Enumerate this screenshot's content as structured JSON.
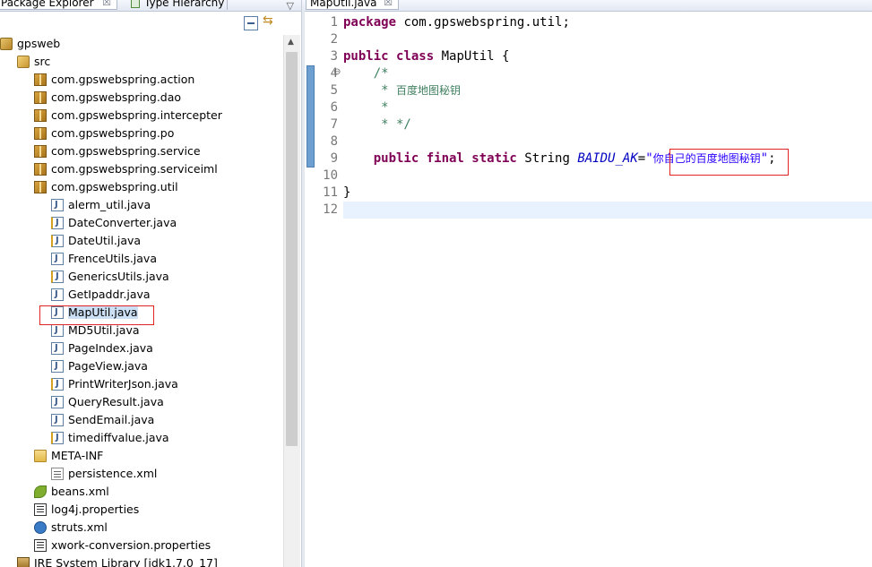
{
  "left_panel": {
    "tabs": [
      {
        "label": "Package Explorer",
        "close": "☒"
      },
      {
        "label": "Type Hierarchy"
      }
    ],
    "view_menu_icon": "▽",
    "toolbar": {
      "collapse_all_icon": "collapse-all-icon",
      "link_with_editor_icon": "⇆"
    },
    "tree": [
      {
        "label": "gpsweb",
        "icon": "project"
      },
      {
        "label": "src",
        "icon": "src"
      },
      {
        "label": "com.gpswebspring.action",
        "icon": "package"
      },
      {
        "label": "com.gpswebspring.dao",
        "icon": "package"
      },
      {
        "label": "com.gpswebspring.intercepter",
        "icon": "package"
      },
      {
        "label": "com.gpswebspring.po",
        "icon": "package"
      },
      {
        "label": "com.gpswebspring.service",
        "icon": "package"
      },
      {
        "label": "com.gpswebspring.serviceiml",
        "icon": "package"
      },
      {
        "label": "com.gpswebspring.util",
        "icon": "package"
      },
      {
        "label": "alerm_util.java",
        "icon": "java"
      },
      {
        "label": "DateConverter.java",
        "icon": "java-warn"
      },
      {
        "label": "DateUtil.java",
        "icon": "java-warn"
      },
      {
        "label": "FrenceUtils.java",
        "icon": "java"
      },
      {
        "label": "GenericsUtils.java",
        "icon": "java-warn"
      },
      {
        "label": "GetIpaddr.java",
        "icon": "java"
      },
      {
        "label": "MapUtil.java",
        "icon": "java"
      },
      {
        "label": "MD5Util.java",
        "icon": "java"
      },
      {
        "label": "PageIndex.java",
        "icon": "java"
      },
      {
        "label": "PageView.java",
        "icon": "java"
      },
      {
        "label": "PrintWriterJson.java",
        "icon": "java-warn"
      },
      {
        "label": "QueryResult.java",
        "icon": "java"
      },
      {
        "label": "SendEmail.java",
        "icon": "java"
      },
      {
        "label": "timediffvalue.java",
        "icon": "java-warn"
      },
      {
        "label": "META-INF",
        "icon": "folder"
      },
      {
        "label": "persistence.xml",
        "icon": "xml"
      },
      {
        "label": "beans.xml",
        "icon": "leaf"
      },
      {
        "label": "log4j.properties",
        "icon": "props"
      },
      {
        "label": "struts.xml",
        "icon": "struts"
      },
      {
        "label": "xwork-conversion.properties",
        "icon": "props"
      },
      {
        "label": "JRE System Library [jdk1.7.0_17]",
        "icon": "library"
      }
    ]
  },
  "editor": {
    "tab": {
      "label": "MapUtil.java",
      "close": "☒"
    },
    "line_numbers": [
      "1",
      "2",
      "3",
      "4",
      "5",
      "6",
      "7",
      "8",
      "9",
      "10",
      "11",
      "12"
    ],
    "fold_marker": "⊖",
    "code": {
      "l1_kw": "package",
      "l1_rest": " com.gpswebspring.util;",
      "l3_kw1": "public",
      "l3_kw2": "class",
      "l3_rest": " MapUtil {",
      "l4": "    /*",
      "l5_prefix": "     * ",
      "l5_text": "百度地图秘钥",
      "l6": "     *",
      "l7": "     * */",
      "l9_kw": "public final static",
      "l9_type": " String ",
      "l9_field": "BAIDU_AK",
      "l9_eq": "=",
      "l9_q1": "\"",
      "l9_str": "你自己的百度地图秘钥",
      "l9_q2": "\"",
      "l9_end": ";",
      "l11": "}"
    }
  },
  "colors": {
    "keyword": "#7f0055",
    "comment": "#3f7f5f",
    "field": "#0000c0",
    "string": "#2a00ff",
    "highlight_box": "#e02424"
  }
}
